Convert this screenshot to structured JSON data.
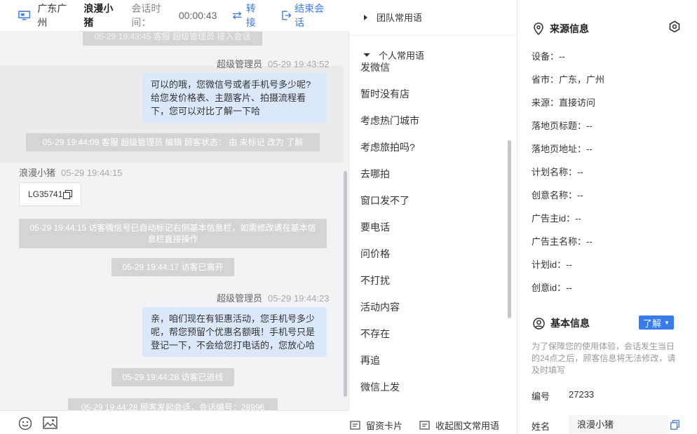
{
  "header": {
    "location": "广东广州",
    "visitor_name": "浪漫小猪",
    "time_label": "会话时间：",
    "time_value": "00:00:43",
    "transfer_label": "转接",
    "end_label": "结束会话"
  },
  "messages": {
    "sys_top": "05-29 19:43:45 客服 超级管理员 接入会话",
    "agent_1_name": "超级管理员",
    "agent_1_time": "05-29 19:43:52",
    "agent_1_text": "可以的哦，您微信号或者手机号多少呢?给您发价格表、主题客片、拍摄流程看下，您可以对比了解一下哈",
    "sys_edit": "05-29 19:44:09 客服 超级管理员 编辑 顾客状态： 由 未标记 改为 了解",
    "visitor_name": "浪漫小猪",
    "visitor_time": "05-29 19:44:15",
    "visitor_code": "LG35741",
    "sys_wechat": "05-29 19:44:15 访客微信号已自动标记右侧基本信息栏，如需修改请在基本信息栏直接操作",
    "sys_left": "05-29 19:44:17 访客已离开",
    "agent_2_name": "超级管理员",
    "agent_2_time": "05-29 19:44:23",
    "agent_2_text": "亲，咱们现在有钜惠活动，您手机号多少呢，帮您预留个优惠名额哦！手机号只是登记一下，不会给您打电话的，您放心哈",
    "sys_entered": "05-29 19:44:28 访客已进线",
    "sys_bottom": "05-29 19:44:28 顾客发起会话，会话编号：28996"
  },
  "footer": {
    "emoji_icon": "smiley-icon",
    "image_icon": "image-icon",
    "leave_card": "留资卡片",
    "collapse_phrases": "收起图文常用语"
  },
  "phrases": {
    "team_group": "团队常用语",
    "personal_group": "个人常用语",
    "items": [
      "发微信",
      "暂时没有店",
      "考虑热门城市",
      "考虑旅拍吗?",
      "去哪拍",
      "窗口发不了",
      "要电话",
      "问价格",
      "不打扰",
      "活动内容",
      "不存在",
      "再追",
      "微信上发"
    ]
  },
  "source_info": {
    "title": "来源信息",
    "rows": [
      "设备：--",
      "省市：广东，广州",
      "来源：直接访问",
      "落地页标题：--",
      "落地页地址：--",
      "计划名称：--",
      "创意名称：--",
      "广告主id：--",
      "广告主名称：--",
      "计划id：--",
      "创意id：--"
    ]
  },
  "basic_info": {
    "title": "基本信息",
    "status_button": "了解",
    "notice": "为了保障您的使用体验，会话发生当日的24点之后，顾客信息将无法修改，请及时填写",
    "id_label": "编号",
    "id_value": "27233",
    "name_label": "姓名",
    "name_value": "浪漫小猪"
  },
  "colors": {
    "accent": "#3a7af0",
    "bubble": "#dbe8fc",
    "system_msg": "#d3d4d6",
    "chat_bg": "#f2f3f5"
  }
}
